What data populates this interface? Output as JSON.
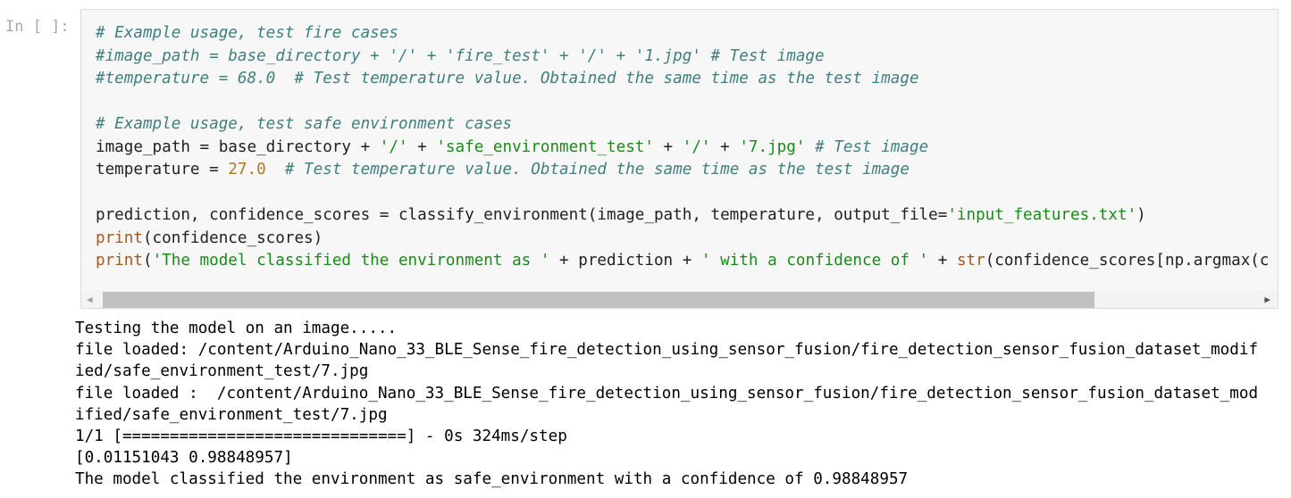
{
  "prompt": "In [ ]:",
  "code": [
    [
      {
        "t": "# Example usage, test fire cases",
        "c": "cm"
      }
    ],
    [
      {
        "t": "#image_path = base_directory + '/' + 'fire_test' + '/' + '1.jpg' # Test image",
        "c": "cm"
      }
    ],
    [
      {
        "t": "#temperature = 68.0  # Test temperature value. Obtained the same time as the test image",
        "c": "cm"
      }
    ],
    [],
    [
      {
        "t": "# Example usage, test safe environment cases",
        "c": "cm"
      }
    ],
    [
      {
        "t": "image_path = base_directory + "
      },
      {
        "t": "'/'",
        "c": "st"
      },
      {
        "t": " + "
      },
      {
        "t": "'safe_environment_test'",
        "c": "st"
      },
      {
        "t": " + "
      },
      {
        "t": "'/'",
        "c": "st"
      },
      {
        "t": " + "
      },
      {
        "t": "'7.jpg'",
        "c": "st"
      },
      {
        "t": " "
      },
      {
        "t": "# Test image",
        "c": "cm"
      }
    ],
    [
      {
        "t": "temperature = "
      },
      {
        "t": "27.0",
        "c": "nm"
      },
      {
        "t": "  "
      },
      {
        "t": "# Test temperature value. Obtained the same time as the test image",
        "c": "cm"
      }
    ],
    [],
    [
      {
        "t": "prediction, confidence_scores = classify_environment(image_path, temperature, output_file="
      },
      {
        "t": "'input_features.txt'",
        "c": "st"
      },
      {
        "t": ")"
      }
    ],
    [
      {
        "t": "print",
        "c": "bi"
      },
      {
        "t": "(confidence_scores)"
      }
    ],
    [
      {
        "t": "print",
        "c": "bi"
      },
      {
        "t": "("
      },
      {
        "t": "'The model classified the environment as '",
        "c": "st"
      },
      {
        "t": " + prediction + "
      },
      {
        "t": "' with a confidence of '",
        "c": "st"
      },
      {
        "t": " + "
      },
      {
        "t": "str",
        "c": "bi"
      },
      {
        "t": "(confidence_scores[np.argmax(c"
      }
    ]
  ],
  "scrollbar": {
    "left_arrow": "◀",
    "right_arrow": "▶"
  },
  "output": [
    "Testing the model on an image.....",
    "file loaded: /content/Arduino_Nano_33_BLE_Sense_fire_detection_using_sensor_fusion/fire_detection_sensor_fusion_dataset_modif",
    "ied/safe_environment_test/7.jpg",
    "file loaded :  /content/Arduino_Nano_33_BLE_Sense_fire_detection_using_sensor_fusion/fire_detection_sensor_fusion_dataset_mod",
    "ified/safe_environment_test/7.jpg",
    "1/1 [==============================] - 0s 324ms/step",
    "[0.01151043 0.98848957]",
    "The model classified the environment as safe_environment with a confidence of 0.98848957"
  ]
}
